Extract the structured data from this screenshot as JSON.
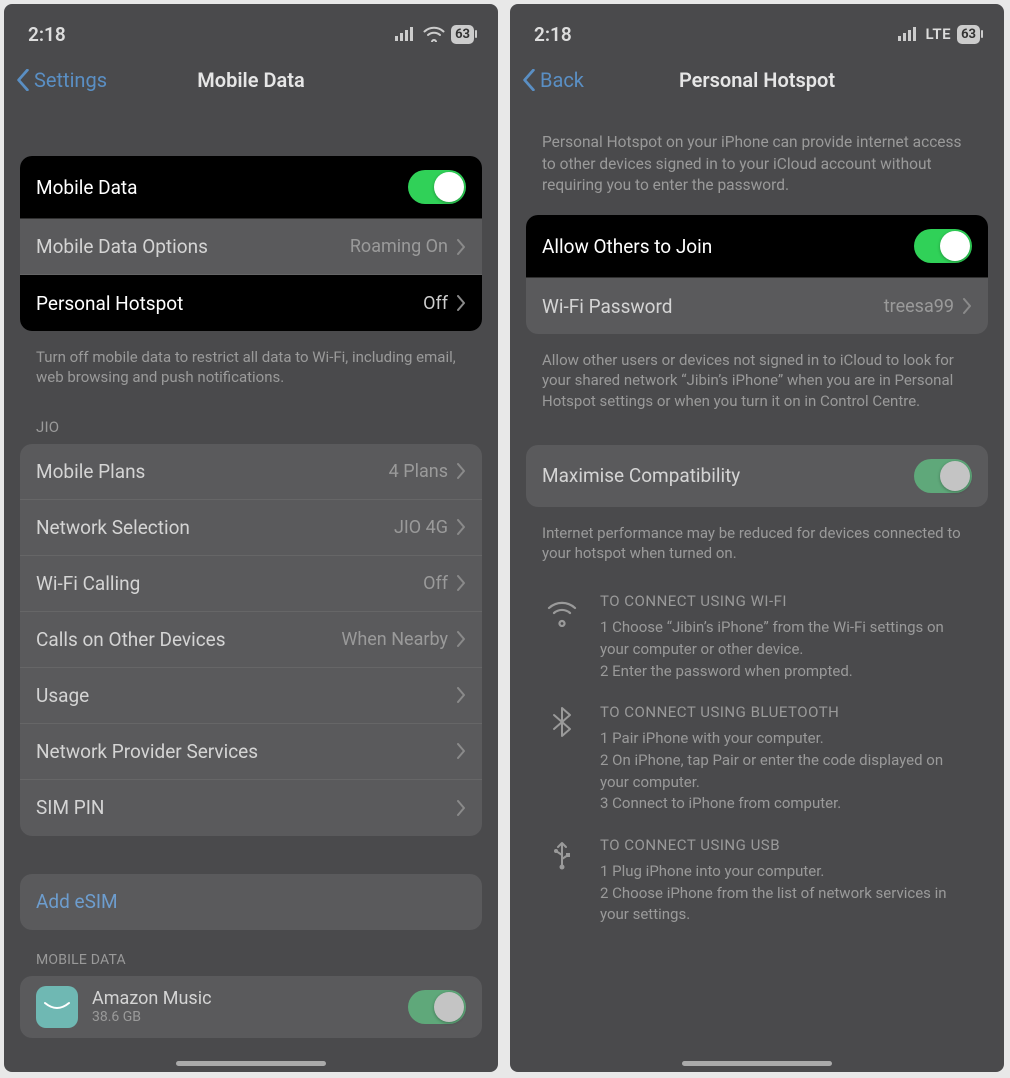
{
  "left": {
    "status": {
      "time": "2:18",
      "battery": "63"
    },
    "nav": {
      "back": "Settings",
      "title": "Mobile Data"
    },
    "group1": {
      "mobileData": "Mobile Data",
      "options": {
        "label": "Mobile Data Options",
        "value": "Roaming On"
      },
      "hotspot": {
        "label": "Personal Hotspot",
        "value": "Off"
      }
    },
    "footer1": "Turn off mobile data to restrict all data to Wi-Fi, including email, web browsing and push notifications.",
    "jioHeader": "JIO",
    "jio": {
      "plans": {
        "label": "Mobile Plans",
        "value": "4 Plans"
      },
      "network": {
        "label": "Network Selection",
        "value": "JIO 4G"
      },
      "wifiCalling": {
        "label": "Wi-Fi Calling",
        "value": "Off"
      },
      "callsOther": {
        "label": "Calls on Other Devices",
        "value": "When Nearby"
      },
      "usage": "Usage",
      "provider": "Network Provider Services",
      "simpin": "SIM PIN"
    },
    "addEsim": "Add eSIM",
    "mobileDataHeader": "MOBILE DATA",
    "app": {
      "name": "Amazon Music",
      "sub": "38.6 GB"
    }
  },
  "right": {
    "status": {
      "time": "2:18",
      "net": "LTE",
      "battery": "63"
    },
    "nav": {
      "back": "Back",
      "title": "Personal Hotspot"
    },
    "desc1": "Personal Hotspot on your iPhone can provide internet access to other devices signed in to your iCloud account without requiring you to enter the password.",
    "allow": "Allow Others to Join",
    "wifiPass": {
      "label": "Wi-Fi Password",
      "value": "treesa99"
    },
    "desc2": "Allow other users or devices not signed in to iCloud to look for your shared network “Jibin’s iPhone” when you are in Personal Hotspot settings or when you turn it on in Control Centre.",
    "maxCompat": "Maximise Compatibility",
    "desc3": "Internet performance may be reduced for devices connected to your hotspot when turned on.",
    "wifi": {
      "heading": "TO CONNECT USING WI-FI",
      "line1": "1 Choose “Jibin’s iPhone” from the Wi-Fi settings on your computer or other device.",
      "line2": "2 Enter the password when prompted."
    },
    "bt": {
      "heading": "TO CONNECT USING BLUETOOTH",
      "line1": "1 Pair iPhone with your computer.",
      "line2": "2 On iPhone, tap Pair or enter the code displayed on your computer.",
      "line3": "3 Connect to iPhone from computer."
    },
    "usb": {
      "heading": "TO CONNECT USING USB",
      "line1": "1 Plug iPhone into your computer.",
      "line2": "2 Choose iPhone from the list of network services in your settings."
    }
  }
}
